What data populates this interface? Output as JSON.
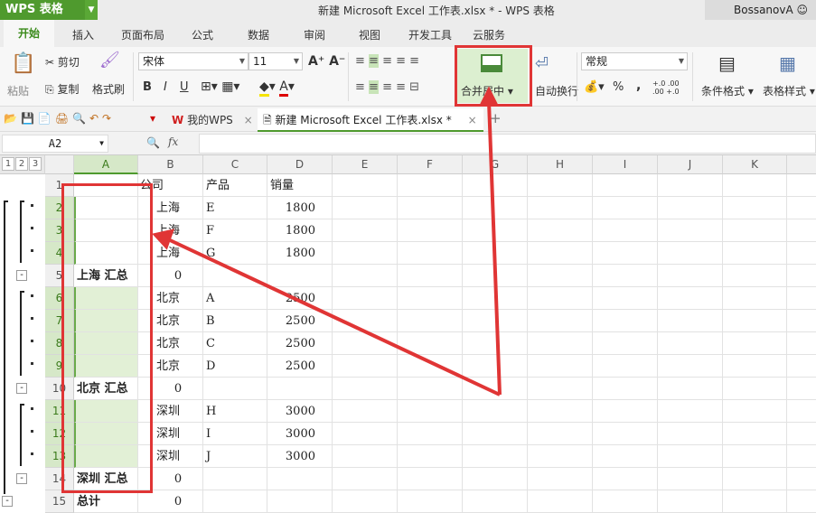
{
  "app": {
    "name": "WPS 表格",
    "title": "新建 Microsoft Excel 工作表.xlsx * - WPS 表格",
    "user": "BossanovA"
  },
  "tabs": [
    "开始",
    "插入",
    "页面布局",
    "公式",
    "数据",
    "审阅",
    "视图",
    "开发工具",
    "云服务"
  ],
  "ribbon": {
    "paste": "粘贴",
    "cut": "剪切",
    "copy": "复制",
    "format_painter": "格式刷",
    "font": "宋体",
    "size": "11",
    "bold": "B",
    "italic": "I",
    "underline": "U",
    "merge_center": "合并居中",
    "wrap": "自动换行",
    "number_format": "常规",
    "percent": "%",
    "comma": ",",
    "cond_format": "条件格式",
    "table_style": "表格样式"
  },
  "docbar": {
    "mywps": "我的WPS",
    "file": "新建 Microsoft Excel 工作表.xlsx *",
    "close": "×",
    "add": "+"
  },
  "formula": {
    "namebox": "A2",
    "fx": "fx",
    "value": ""
  },
  "outline_levels": [
    "1",
    "2",
    "3"
  ],
  "columns": [
    "A",
    "B",
    "C",
    "D",
    "E",
    "F",
    "G",
    "H",
    "I",
    "J",
    "K"
  ],
  "rows": [
    {
      "n": "1",
      "A": "",
      "B": "公司",
      "C": "产品",
      "D": "销量"
    },
    {
      "n": "2",
      "A": "",
      "B": "上海",
      "C": "E",
      "D": "1800"
    },
    {
      "n": "3",
      "A": "",
      "B": "上海",
      "C": "F",
      "D": "1800"
    },
    {
      "n": "4",
      "A": "",
      "B": "上海",
      "C": "G",
      "D": "1800"
    },
    {
      "n": "5",
      "A": "上海  汇总",
      "B": "0",
      "C": "",
      "D": ""
    },
    {
      "n": "6",
      "A": "",
      "B": "北京",
      "C": "A",
      "D": "2500"
    },
    {
      "n": "7",
      "A": "",
      "B": "北京",
      "C": "B",
      "D": "2500"
    },
    {
      "n": "8",
      "A": "",
      "B": "北京",
      "C": "C",
      "D": "2500"
    },
    {
      "n": "9",
      "A": "",
      "B": "北京",
      "C": "D",
      "D": "2500"
    },
    {
      "n": "10",
      "A": "北京  汇总",
      "B": "0",
      "C": "",
      "D": ""
    },
    {
      "n": "11",
      "A": "",
      "B": "深圳",
      "C": "H",
      "D": "3000"
    },
    {
      "n": "12",
      "A": "",
      "B": "深圳",
      "C": "I",
      "D": "3000"
    },
    {
      "n": "13",
      "A": "",
      "B": "深圳",
      "C": "J",
      "D": "3000"
    },
    {
      "n": "14",
      "A": "深圳  汇总",
      "B": "0",
      "C": "",
      "D": ""
    },
    {
      "n": "15",
      "A": "总计",
      "B": "0",
      "C": "",
      "D": ""
    }
  ],
  "colors": {
    "accent": "#4f9a2e",
    "selection": "#e2f0d6",
    "annotation": "#e03535"
  }
}
